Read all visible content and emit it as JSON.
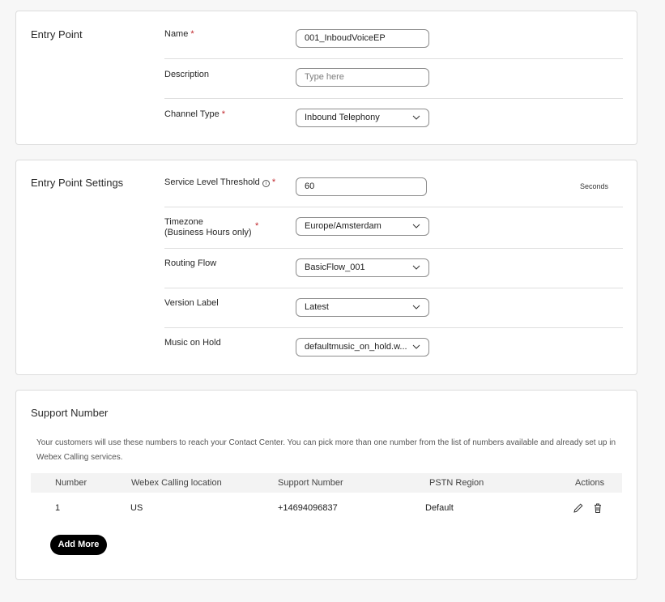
{
  "entry_point": {
    "title": "Entry Point",
    "name_label": "Name",
    "name_value": "001_InboudVoiceEP",
    "description_label": "Description",
    "description_placeholder": "Type here",
    "channel_label": "Channel Type",
    "channel_value": "Inbound Telephony",
    "required_mark": "*"
  },
  "settings": {
    "title": "Entry Point Settings",
    "threshold_label": "Service Level Threshold",
    "threshold_info": "i",
    "threshold_value": "60",
    "threshold_unit": "Seconds",
    "timezone_label_line1": "Timezone",
    "timezone_label_line2": "(Business Hours only)",
    "timezone_value": "Europe/Amsterdam",
    "routing_label": "Routing Flow",
    "routing_value": "BasicFlow_001",
    "version_label": "Version Label",
    "version_value": "Latest",
    "music_label": "Music on Hold",
    "music_value": "defaultmusic_on_hold.w..."
  },
  "support": {
    "title": "Support Number",
    "help_text": "Your customers will use these numbers to reach your Contact Center. You can pick more than one number from the list of numbers available and already set up in Webex Calling services.",
    "columns": [
      "Number",
      "Webex Calling location",
      "Support Number",
      "PSTN Region",
      "Actions"
    ],
    "rows": [
      {
        "number": "1",
        "location": "US",
        "support_number": "+14694096837",
        "region": "Default"
      }
    ],
    "add_more_label": "Add More"
  },
  "icons": {
    "dropdown": "chevron-down-icon",
    "edit": "pencil-icon",
    "delete": "trash-icon",
    "info": "info-icon"
  }
}
